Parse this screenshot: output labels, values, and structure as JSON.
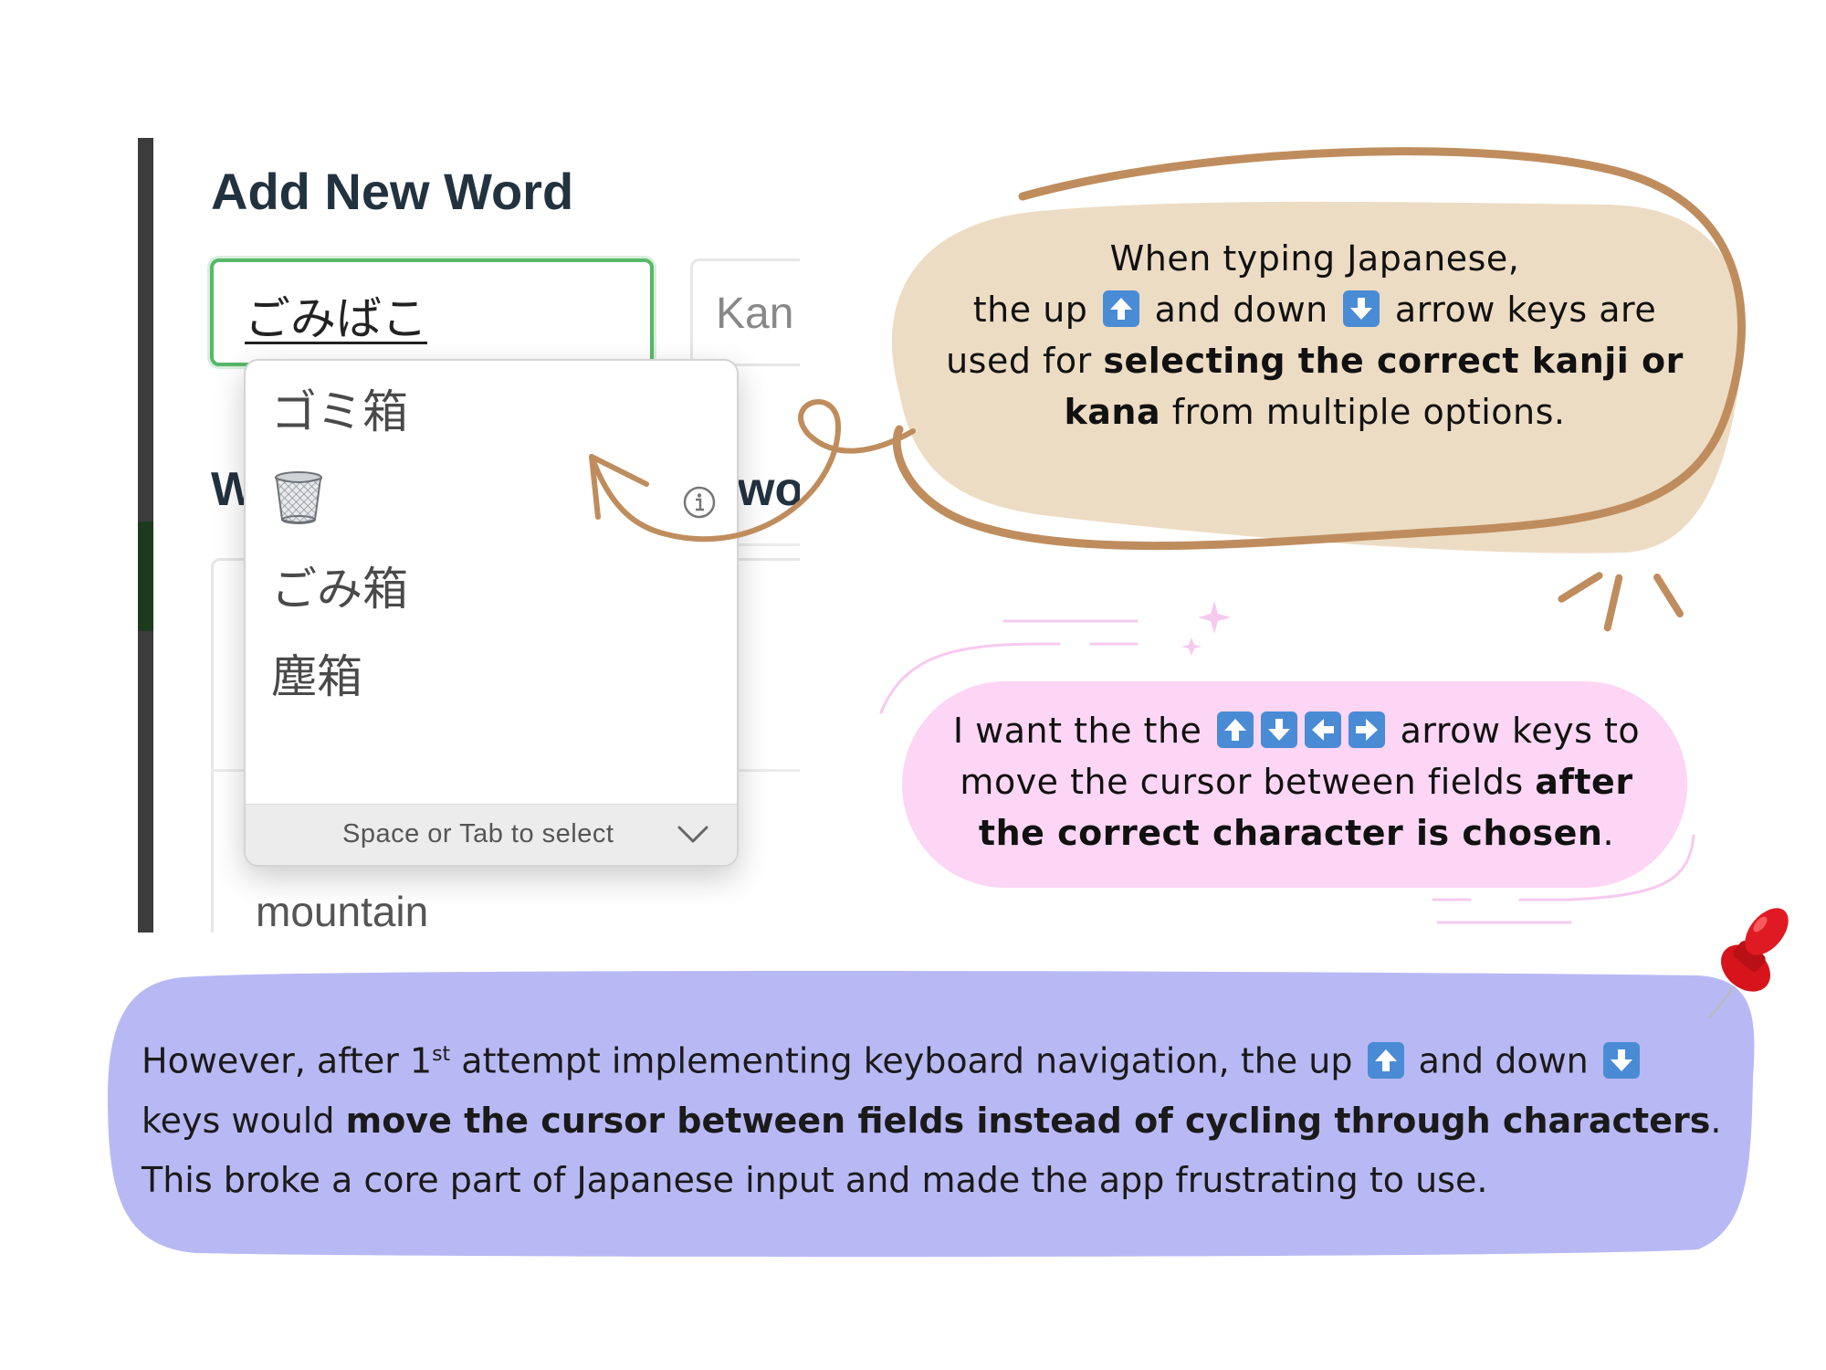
{
  "screenshot": {
    "heading": "Add New Word",
    "word_input_value": "ごみばこ",
    "kanji_input_placeholder": "Kan",
    "section_heading_fragment_left": "W",
    "section_heading_fragment_right": "wo",
    "list_item_meaning": "mountain",
    "ime_candidates": {
      "items": [
        "ゴミ箱",
        "ごみ箱",
        "塵箱"
      ],
      "icons": [
        "wastebasket-icon",
        "info-icon",
        "chevron-down-icon"
      ],
      "footer_hint": "Space or Tab to select"
    }
  },
  "callouts": {
    "bubble_1": {
      "line1": "When typing Japanese,",
      "line2a": "the up",
      "line2b": "and down",
      "line2c": "arrow keys are",
      "line3a": "used for",
      "bold_1": "selecting the correct kanji or",
      "bold_2": "kana",
      "line4b": "from multiple options.",
      "bubble_color": "#eddcc4",
      "outline_color": "#bf8d5d"
    },
    "bubble_2": {
      "part1": "I want the the",
      "part2": "arrow keys to",
      "part3": "move the cursor between fields",
      "bold_1": "after",
      "bold_2": "the correct character is chosen",
      "end": ".",
      "bubble_color": "#fcd6f4"
    },
    "bottom": {
      "part1": "However, after 1",
      "superscript": "st",
      "part2": "attempt implementing keyboard navigation, the up",
      "part3": "and down",
      "part4": "keys would",
      "bold": "move the cursor between fields instead of cycling through characters",
      "part5": ".",
      "part6": "This broke a core part of Japanese input and made the app frustrating to use.",
      "bubble_color": "#b8b9f4",
      "pin_color": "#d7141c"
    },
    "key_icon_color": "#4a8bd6"
  }
}
